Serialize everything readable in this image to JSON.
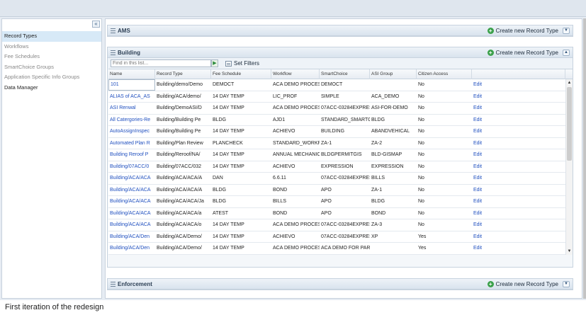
{
  "sidebar": {
    "collapse_icon": "double-chevron-left-icon",
    "items": [
      {
        "label": "Record Types"
      },
      {
        "label": "Workflows"
      },
      {
        "label": "Fee Schedules"
      },
      {
        "label": "SmartChoice Groups"
      },
      {
        "label": "Application Specific Info Groups"
      },
      {
        "label": "Data Manager"
      }
    ]
  },
  "panels": {
    "ams": {
      "title": "AMS",
      "create_label": "Create new Record Type"
    },
    "building": {
      "title": "Building",
      "create_label": "Create new Record Type"
    },
    "enforcement": {
      "title": "Enforcement",
      "create_label": "Create new Record Type"
    }
  },
  "toolbar": {
    "search_placeholder": "Find in this list...",
    "filter_label": "Set Filters"
  },
  "grid": {
    "columns": [
      "Name",
      "Record Type",
      "Fee Schedule",
      "Workflow",
      "SmartChoice",
      "ASI Group",
      "Citizen Access",
      ""
    ],
    "rows": [
      [
        "101",
        "Building/demo/Demo",
        "DEMOCT",
        "ACA DEMO PROCESS",
        "DEMOCT",
        "",
        "No",
        "Edit"
      ],
      [
        "ALIAS of ACA_AS",
        "Building/ACA/demo/",
        "14 DAY TEMP",
        "LIC_PROF",
        "SIMPLE",
        "ACA_DEMO",
        "No",
        "Edit"
      ],
      [
        "ASI Renwal",
        "Building/DemoASI/D",
        "14 DAY TEMP",
        "ACA DEMO PROCESS",
        "07ACC-03284EXPRESS",
        "ASI-FOR-DEMO",
        "No",
        "Edit"
      ],
      [
        "All Catergories-Re",
        "Building/Building Pe",
        "BLDG",
        "AJD1",
        "STANDARD_SMARTCHOICE",
        "BLDG",
        "No",
        "Edit"
      ],
      [
        "AutoAssignInspec",
        "Building/Building Pe",
        "14 DAY TEMP",
        "ACHIEVO",
        "BUILDING",
        "ABANDVEHICAL",
        "No",
        "Edit"
      ],
      [
        "Automated Plan R",
        "Building/Plan Review",
        "PLANCHECK",
        "STANDARD_WORKFLOW",
        "ZA-1",
        "ZA-2",
        "No",
        "Edit"
      ],
      [
        "Building Reroof P",
        "Building/Reroof/NA/",
        "14 DAY TEMP",
        "ANNUAL MECHANICAL",
        "BLDGPERMITGIS",
        "BLD-GISMAP",
        "No",
        "Edit"
      ],
      [
        "Building/07ACC/0",
        "Building/07ACC/032",
        "14 DAY TEMP",
        "ACHIEVO",
        "EXPRESSION",
        "EXPRESSION",
        "No",
        "Edit"
      ],
      [
        "Building/ACA/ACA",
        "Building/ACA/ACA/A",
        "DAN",
        "6.6.11",
        "07ACC-03284EXPRESS",
        "BILLS",
        "No",
        "Edit"
      ],
      [
        "Building/ACA/ACA",
        "Building/ACA/ACA/A",
        "BLDG",
        "BOND",
        "APO",
        "ZA-1",
        "No",
        "Edit"
      ],
      [
        "Building/ACA/ACA",
        "Building/ACA/ACA/Ja",
        "BLDG",
        "BILLS",
        "APO",
        "BLDG",
        "No",
        "Edit"
      ],
      [
        "Building/ACA/ACA",
        "Building/ACA/ACA/a",
        "ATEST",
        "BOND",
        "APO",
        "BOND",
        "No",
        "Edit"
      ],
      [
        "Building/ACA/ACA",
        "Building/ACA/ACA/o",
        "14 DAY TEMP",
        "ACA DEMO PROCESS",
        "07ACC-03284EXPRESS",
        "ZA-3",
        "No",
        "Edit"
      ],
      [
        "Building/ACA/Den",
        "Building/ACA/Demo/",
        "14 DAY TEMP",
        "ACHIEVO",
        "07ACC-03284EXPRESS",
        "XP",
        "Yes",
        "Edit"
      ],
      [
        "Building/ACA/Den",
        "Building/ACA/Demo/",
        "14 DAY TEMP",
        "ACA DEMO PROCESS",
        "ACA DEMO FOR PARDASI",
        "",
        "Yes",
        "Edit"
      ]
    ]
  },
  "caption": "First iteration of the redesign"
}
